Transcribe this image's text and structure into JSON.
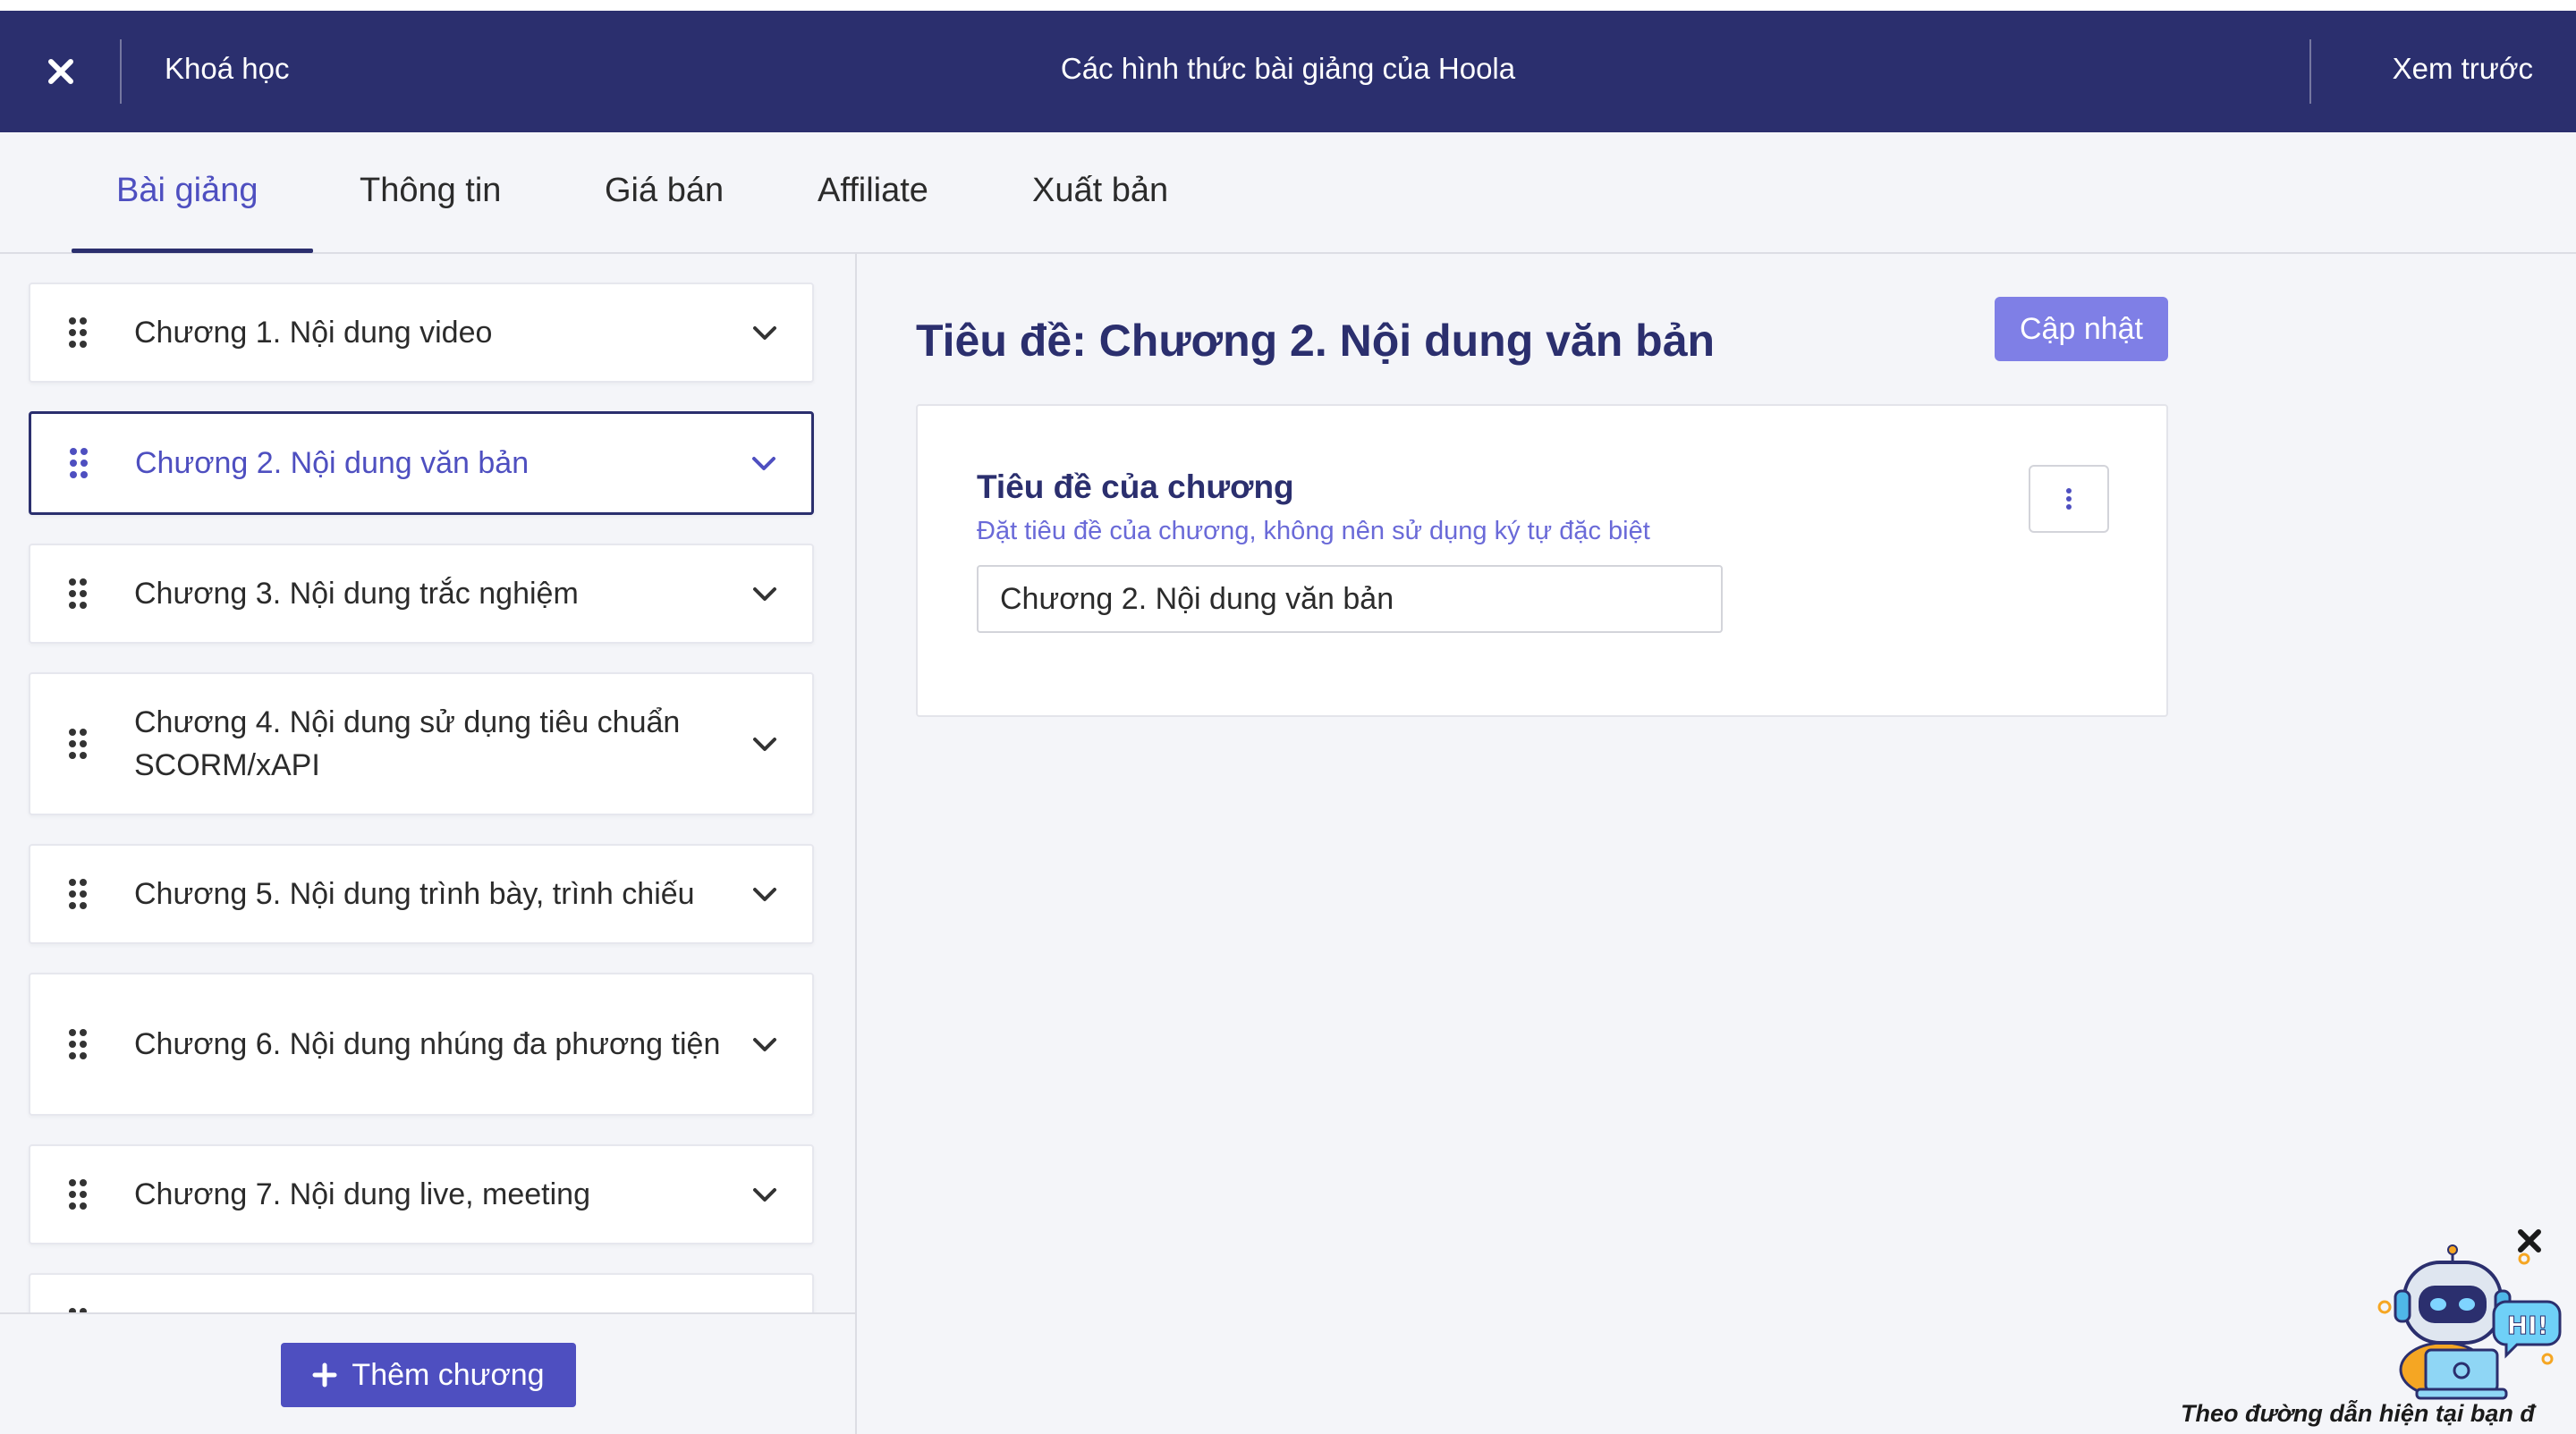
{
  "header": {
    "back_label": "Khoá học",
    "title": "Các hình thức bài giảng của Hoola",
    "preview_label": "Xem trước",
    "bg_color": "#2b2f6e"
  },
  "tabs": [
    {
      "label": "Bài giảng",
      "active": true
    },
    {
      "label": "Thông tin",
      "active": false
    },
    {
      "label": "Giá bán",
      "active": false
    },
    {
      "label": "Affiliate",
      "active": false
    },
    {
      "label": "Xuất bản",
      "active": false
    }
  ],
  "sidebar": {
    "chapters": [
      {
        "label": "Chương 1. Nội dung video",
        "active": false
      },
      {
        "label": "Chương 2. Nội dung văn bản",
        "active": true
      },
      {
        "label": "Chương 3. Nội dung trắc nghiệm",
        "active": false
      },
      {
        "label": "Chương 4. Nội dung sử dụng tiêu chuẩn SCORM/xAPI",
        "active": false
      },
      {
        "label": "Chương 5. Nội dung trình bày, trình chiếu",
        "active": false
      },
      {
        "label": "Chương 6. Nội dung nhúng đa phương tiện",
        "active": false
      },
      {
        "label": "Chương 7. Nội dung live, meeting",
        "active": false
      }
    ],
    "add_chapter_label": "Thêm chương"
  },
  "main": {
    "heading": "Tiêu đề: Chương 2. Nội dung văn bản",
    "update_label": "Cập nhật",
    "field_title": "Tiêu đề của chương",
    "field_hint": "Đặt tiêu đề của chương, không nên sử dụng ký tự đặc biệt",
    "field_value": "Chương 2. Nội dung văn bản"
  },
  "chatbot": {
    "bubble_text": "HI!",
    "caption": "Theo đường dẫn hiện tại bạn đ"
  },
  "colors": {
    "accent": "#4e4fc0",
    "update_button": "#7f7fe6",
    "active_border": "#2b2f6e"
  }
}
